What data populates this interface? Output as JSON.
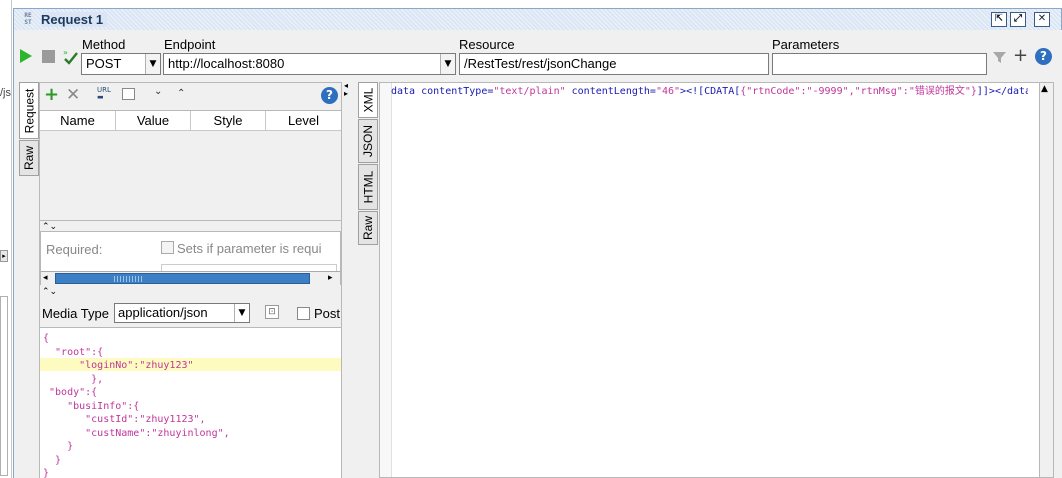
{
  "window": {
    "tab_badge": "RE\nST",
    "title": "Request 1"
  },
  "toolbar": {
    "method_label": "Method",
    "method_value": "POST",
    "endpoint_label": "Endpoint",
    "endpoint_value": "http://localhost:8080",
    "resource_label": "Resource",
    "resource_value": "/RestTest/rest/jsonChange",
    "parameters_label": "Parameters",
    "parameters_value": ""
  },
  "left_panel": {
    "tabs": [
      "Request",
      "Raw"
    ],
    "columns": [
      "Name",
      "Value",
      "Style",
      "Level"
    ],
    "required_label": "Required:",
    "sets_if_label": "Sets if parameter is requi",
    "media_type_label": "Media Type",
    "media_type_value": "application/json",
    "post_label": "Post"
  },
  "request_body": [
    "{",
    "  \"root\":{",
    "      \"loginNo\":\"zhuy123\"",
    "        },",
    " \"body\":{",
    "    \"busiInfo\":{",
    "       \"custId\":\"zhuy1123\",",
    "       \"custName\":\"zhuyinlong\",",
    "    }",
    "  }",
    "}"
  ],
  "right_panel": {
    "tabs": [
      "XML",
      "JSON",
      "HTML",
      "Raw"
    ],
    "response_segments": [
      {
        "t": "data",
        "c": "k"
      },
      {
        "t": " contentType=",
        "c": "k"
      },
      {
        "t": "\"text/plain\"",
        "c": "s"
      },
      {
        "t": " contentLength=",
        "c": "k"
      },
      {
        "t": "\"46\"",
        "c": "s"
      },
      {
        "t": ">",
        "c": "k"
      },
      {
        "t": "<![CDATA[",
        "c": "k"
      },
      {
        "t": "{\"rtnCode\":\"-9999\",\"rtnMsg\":\"错误的报文\"}",
        "c": "s"
      },
      {
        "t": "]]>",
        "c": "k"
      },
      {
        "t": "</data>",
        "c": "k"
      }
    ]
  },
  "edge_text": {
    "left_cut": "/js"
  },
  "colors": {
    "title_bg": "#dbe6f4",
    "highlight_line": "#fdfbc0",
    "scroll_thumb": "#3c7fc4",
    "keyword": "#1a1ab4",
    "string": "#c0369b"
  }
}
